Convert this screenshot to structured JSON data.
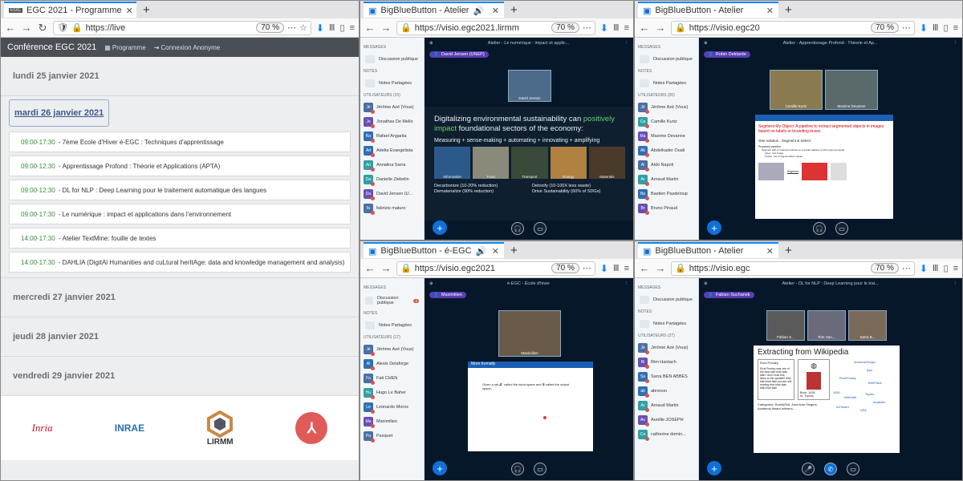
{
  "w1": {
    "tab": "EGC 2021 - Programme",
    "url": "https://live",
    "zoom": "70 %",
    "header": {
      "title": "Conférence EGC 2021",
      "link1": "Programme",
      "link2": "Connexion Anonyme"
    },
    "days": {
      "d1": "lundi 25 janvier 2021",
      "d2": "mardi 26 janvier 2021",
      "d3": "mercredi 27 janvier 2021",
      "d4": "jeudi 28 janvier 2021",
      "d5": "vendredi 29 janvier 2021"
    },
    "sessions": [
      {
        "time": "09:00-17:30",
        "title": "7ème Ecole d'Hiver é-EGC : Techniques d'apprentissage"
      },
      {
        "time": "09:00-12:30",
        "title": "Apprentissage Profond : Théorie et Applications (APTA)"
      },
      {
        "time": "09:00-12:30",
        "title": "DL for NLP : Deep Learning pour le traitement automatique des langues"
      },
      {
        "time": "09:00-17:30",
        "title": "Le numérique : impact et applications dans l'environnement"
      },
      {
        "time": "14:00-17:30",
        "title": "Atelier TextMine: fouille de textes"
      },
      {
        "time": "14:00-17:30",
        "title": "DAHLIA (DigitAl Humanities and cuLtural herItAge: data and knowledge management and analysis)"
      }
    ],
    "logos": {
      "inria": "Inria",
      "inrae": "INRAE",
      "lirmm": "LIRMM"
    }
  },
  "bbb_labels": {
    "messages": "MESSAGES",
    "public_chat": "Discussion publique",
    "notes": "NOTES",
    "shared_notes": "Notes Partagées"
  },
  "w2": {
    "tab": "BigBlueButton - Atelier",
    "url": "https://visio.egc2021.lirmm",
    "zoom": "70 %",
    "users_header": "UTILISATEURS (15)",
    "title": "Atelier - Le numérique : impact et applic...",
    "presenter": "David Jensen (UNEP)",
    "cam": "David Jensen",
    "users": [
      [
        "Jé",
        "Jérôme Azé (Vous)",
        "#4a6fa5"
      ],
      [
        "Jo",
        "Jonathas De Mello",
        "#6a4fb5"
      ],
      [
        "Ra",
        "Rafael Angarita",
        "#2f6fb5"
      ],
      [
        "Ad",
        "Adelia Evangelista",
        "#2f6fb5"
      ],
      [
        "An",
        "Annalina Sarra",
        "#2fa0a5"
      ],
      [
        "Da",
        "Danielle Ziebelin",
        "#2fa0a5"
      ],
      [
        "Da",
        "David Jensen (U...",
        "#6a4fb5"
      ],
      [
        "fa",
        "fabrizio maturo",
        "#4a6fa5"
      ]
    ],
    "slide": {
      "l1": "Digitalizing environmental sustainability can ",
      "hl": "positively impact",
      "l2": " foundational sectors of the economy:",
      "sub": "Measuring + sense-making + automating + innovating + amplifying",
      "cats": [
        "Information",
        "Food",
        "Transport",
        "Energy",
        "Materials"
      ],
      "b1": "Decarbonize (10-20% reduction)",
      "b2": "Dematerialize (90% reduction)",
      "b3": "Detoxify (10-100X less waste)",
      "b4": "Drive Sustainability (60% of SDGs)"
    }
  },
  "w3": {
    "tab": "BigBlueButton - Atelier",
    "url": "https://visio.egc20",
    "zoom": "70 %",
    "users_header": "UTILISATEURS (26)",
    "title": "Atelier - Apprentissage Profond : Théorie et Ap...",
    "presenter": "Robin Deklarde",
    "cam1": "Camille Kurtz",
    "cam2": "Maxime Devanne",
    "users": [
      [
        "Jé",
        "Jérôme Azé (Vous)",
        "#4a6fa5"
      ],
      [
        "Ca",
        "Camille Kurtz",
        "#2fa0a5"
      ],
      [
        "Ma",
        "Maxime Devanne",
        "#6a4fb5"
      ],
      [
        "Ab",
        "Abdelkader Ouali",
        "#2f6fb5"
      ],
      [
        "Al",
        "Aldo Napoli",
        "#4a6fa5"
      ],
      [
        "Ar",
        "Arnaud Martin",
        "#2fa0a5"
      ],
      [
        "Ba",
        "Bastien Pasdeloup",
        "#2f6fb5"
      ],
      [
        "Br",
        "Bruno Pinaud",
        "#6a4fb5"
      ]
    ],
    "slide": {
      "title": "Segment My Object: A pipeline to extract segmented objects in images based on labels or bounding boxes",
      "s1": "One solution : Segment & Select",
      "s2": "Proposed pipeline",
      "s3": "Segment with a model pre-trained on a similar dataset or with region proposal",
      "s4": "Input : raw image",
      "s5": "Output : list of segmentation masks",
      "arrow": "Segment"
    }
  },
  "w4": {
    "tab": "BigBlueButton - é-EGC",
    "url": "https://visio.egc2021",
    "zoom": "70 %",
    "users_header": "UTILISATEURS (17)",
    "title": "é-EGC - École d'hiver",
    "presenter": "Maximilien",
    "cam": "Maximilien",
    "badge": "2",
    "users": [
      [
        "Jé",
        "Jérôme Azé (Vous)",
        "#4a6fa5"
      ],
      [
        "Al",
        "Alexis Delaforge",
        "#2f6fb5"
      ],
      [
        "Fa",
        "Fati CHEN",
        "#4a6fa5"
      ],
      [
        "Hu",
        "Hugo Le Baher",
        "#2fa0a5"
      ],
      [
        "Le",
        "Leonardo Moros",
        "#2f6fb5"
      ],
      [
        "Ma",
        "Maximilien",
        "#6a4fb5"
      ],
      [
        "Pa",
        "Pasquet",
        "#4a6fa5"
      ]
    ],
    "slide": {
      "title": "More formally",
      "text": "Given a set 𝒳, called the input space and 𝒴 called the output space,"
    }
  },
  "w5": {
    "tab": "BigBlueButton - Atelier",
    "url": "https://visio.egc",
    "zoom": "70 %",
    "users_header": "UTILISATEURS (27)",
    "title": "Atelier - DL for NLP : Deep Learning pour le trai...",
    "presenter": "Fabian Suchanek",
    "cam1": "Fabian S...",
    "cam2": "Rim Han...",
    "cam3": "Sarra B...",
    "users": [
      [
        "Jé",
        "Jérôme Azé (Vous)",
        "#4a6fa5"
      ],
      [
        "Ri",
        "Rim Hantach",
        "#6a4fb5"
      ],
      [
        "Sa",
        "Sarra BEN ABBES",
        "#2f6fb5"
      ],
      [
        "ab",
        "abrenon",
        "#2f6fb5"
      ],
      [
        "Ar",
        "Arnaud Martin",
        "#2fa0a5"
      ],
      [
        "Au",
        "Aurélie JOSEPH",
        "#6a4fb5"
      ],
      [
        "Ca",
        "catherine domin...",
        "#2fa0a5"
      ]
    ],
    "slide": {
      "title": "Extracting from Wikipedia",
      "name": "Elvis Presley",
      "txt": "Elvis Presley was one of the best blah blah blah blah I don't read this, listen to the speaker! blah blah blah blah you are still reading this! blah blah blah blah blah",
      "born": "Born: 1935",
      "in": "In: Tupelo",
      "cat": "Categories: Rock&Roll, American Singers, Academy Award winners...",
      "n1": "AmericanSinger",
      "n2": "type",
      "n3": "ElvisPresley",
      "n4": "birthPlace",
      "n5": "1935",
      "n6": "birthDate",
      "n7": "Tupelo",
      "n8": "locatedIn",
      "n9": "USA",
      "n10": "AtTheard"
    }
  }
}
